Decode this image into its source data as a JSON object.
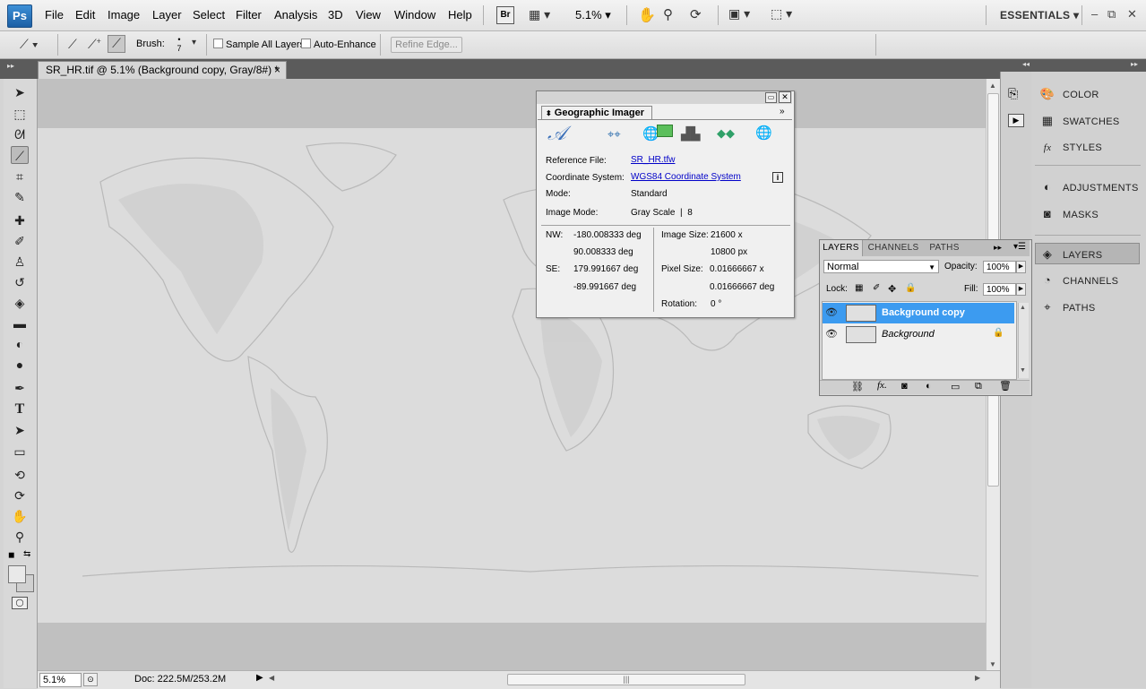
{
  "app": {
    "logo": "Ps",
    "workspace": "ESSENTIALS",
    "zoom_menu": "5.1%",
    "bridge_label": "Br"
  },
  "menu": [
    "File",
    "Edit",
    "Image",
    "Layer",
    "Select",
    "Filter",
    "Analysis",
    "3D",
    "View",
    "Window",
    "Help"
  ],
  "options_bar": {
    "brush_label": "Brush:",
    "brush_size": "7",
    "sample_all_layers": "Sample All Layers",
    "auto_enhance": "Auto-Enhance",
    "refine_edge": "Refine Edge..."
  },
  "document": {
    "tab_title": "SR_HR.tif @ 5.1% (Background copy, Gray/8#) *",
    "close_glyph": "×"
  },
  "status": {
    "zoom": "5.1%",
    "doc_info": "Doc: 222.5M/253.2M"
  },
  "geo_panel": {
    "tab": "Geographic Imager",
    "reference_file_label": "Reference File:",
    "reference_file": "SR_HR.tfw",
    "coord_system_label": "Coordinate System:",
    "coord_system": "WGS84 Coordinate System",
    "mode_label": "Mode:",
    "mode": "Standard",
    "image_mode_label": "Image Mode:",
    "image_mode": "Gray Scale",
    "image_mode_bits": "8",
    "nw_label": "NW:",
    "nw_x": "-180.008333 deg",
    "nw_y": "90.008333 deg",
    "se_label": "SE:",
    "se_x": "179.991667 deg",
    "se_y": "-89.991667 deg",
    "image_size_label": "Image Size:",
    "image_size_w": "21600 x",
    "image_size_h": "10800 px",
    "pixel_size_label": "Pixel Size:",
    "pixel_size_w": "0.01666667 x",
    "pixel_size_h": "0.01666667 deg",
    "rotation_label": "Rotation:",
    "rotation": "0 °"
  },
  "layers_panel": {
    "tabs": [
      "LAYERS",
      "CHANNELS",
      "PATHS"
    ],
    "blend_mode": "Normal",
    "opacity_label": "Opacity:",
    "opacity": "100%",
    "lock_label": "Lock:",
    "fill_label": "Fill:",
    "fill": "100%",
    "layers": [
      {
        "name": "Background copy",
        "selected": true
      },
      {
        "name": "Background",
        "selected": false
      }
    ]
  },
  "dock": {
    "items": [
      {
        "label": "COLOR",
        "icon": "color-palette-icon"
      },
      {
        "label": "SWATCHES",
        "icon": "swatches-grid-icon"
      },
      {
        "label": "STYLES",
        "icon": "styles-fx-icon"
      },
      {
        "label": "ADJUSTMENTS",
        "icon": "adjustments-icon"
      },
      {
        "label": "MASKS",
        "icon": "masks-icon"
      },
      {
        "label": "LAYERS",
        "icon": "layers-icon"
      },
      {
        "label": "CHANNELS",
        "icon": "channels-icon"
      },
      {
        "label": "PATHS",
        "icon": "paths-icon"
      }
    ]
  },
  "colors": {
    "selection": "#3c9bf0",
    "link": "#0000c8",
    "dark_strip": "#5b5b5b"
  }
}
